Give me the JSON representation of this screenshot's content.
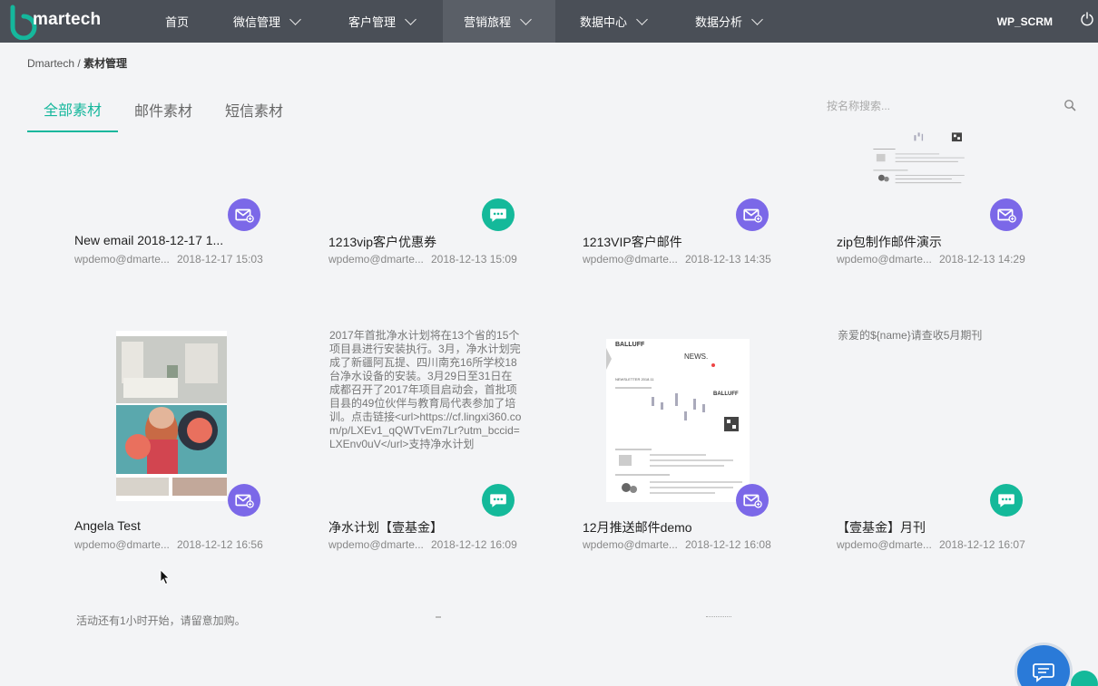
{
  "brand": {
    "name": "martech",
    "accent": "#15b79c",
    "nav_bg": "#4a4f57"
  },
  "nav": {
    "items": [
      {
        "label": "首页",
        "has_menu": false
      },
      {
        "label": "微信管理",
        "has_menu": true
      },
      {
        "label": "客户管理",
        "has_menu": true
      },
      {
        "label": "营销旅程",
        "has_menu": true,
        "active": true
      },
      {
        "label": "数据中心",
        "has_menu": true
      },
      {
        "label": "数据分析",
        "has_menu": true
      }
    ],
    "user": "WP_SCRM"
  },
  "breadcrumb": {
    "root": "Dmartech",
    "separator": " / ",
    "current": "素材管理"
  },
  "tabs": [
    {
      "label": "全部素材",
      "active": true
    },
    {
      "label": "邮件素材",
      "active": false
    },
    {
      "label": "短信素材",
      "active": false
    }
  ],
  "search": {
    "placeholder": "按名称搜索..."
  },
  "cards": [
    {
      "title": "New email 2018-12-17 1...",
      "author": "wpdemo@dmarte...",
      "date": "2018-12-17 15:03",
      "type": "email"
    },
    {
      "title": "1213vip客户优惠券",
      "author": "wpdemo@dmarte...",
      "date": "2018-12-13 15:09",
      "type": "sms"
    },
    {
      "title": "1213VIP客户邮件",
      "author": "wpdemo@dmarte...",
      "date": "2018-12-13 14:35",
      "type": "email"
    },
    {
      "title": "zip包制作邮件演示",
      "author": "wpdemo@dmarte...",
      "date": "2018-12-13 14:29",
      "type": "email"
    },
    {
      "title": "Angela Test",
      "author": "wpdemo@dmarte...",
      "date": "2018-12-12 16:56",
      "type": "email"
    },
    {
      "title": "净水计划【壹基金】",
      "author": "wpdemo@dmarte...",
      "date": "2018-12-12 16:09",
      "type": "sms",
      "preview": "2017年首批净水计划将在13个省的15个项目县进行安装执行。3月，净水计划完成了新疆阿瓦提、四川南充16所学校18台净水设备的安装。3月29日至31日在成都召开了2017年项目启动会，首批项目县的49位伙伴与教育局代表参加了培训。点击链接<url>https://cf.lingxi360.com/p/LXEv1_qQWTvEm7Lr?utm_bccid=LXEnv0uV</url>支持净水计划"
    },
    {
      "title": "12月推送邮件demo",
      "author": "wpdemo@dmarte...",
      "date": "2018-12-12 16:08",
      "type": "email",
      "preview_brand": "BALLUFF",
      "preview_heading": "NEWS.",
      "preview_newsletter": "NEWSLETTER 2018.11"
    },
    {
      "title": "【壹基金】月刊",
      "author": "wpdemo@dmarte...",
      "date": "2018-12-12 16:07",
      "type": "sms",
      "preview": "亲爱的${name}请查收5月期刊"
    }
  ],
  "row3": {
    "preview": "活动还有1小时开始，请留意加购。"
  }
}
